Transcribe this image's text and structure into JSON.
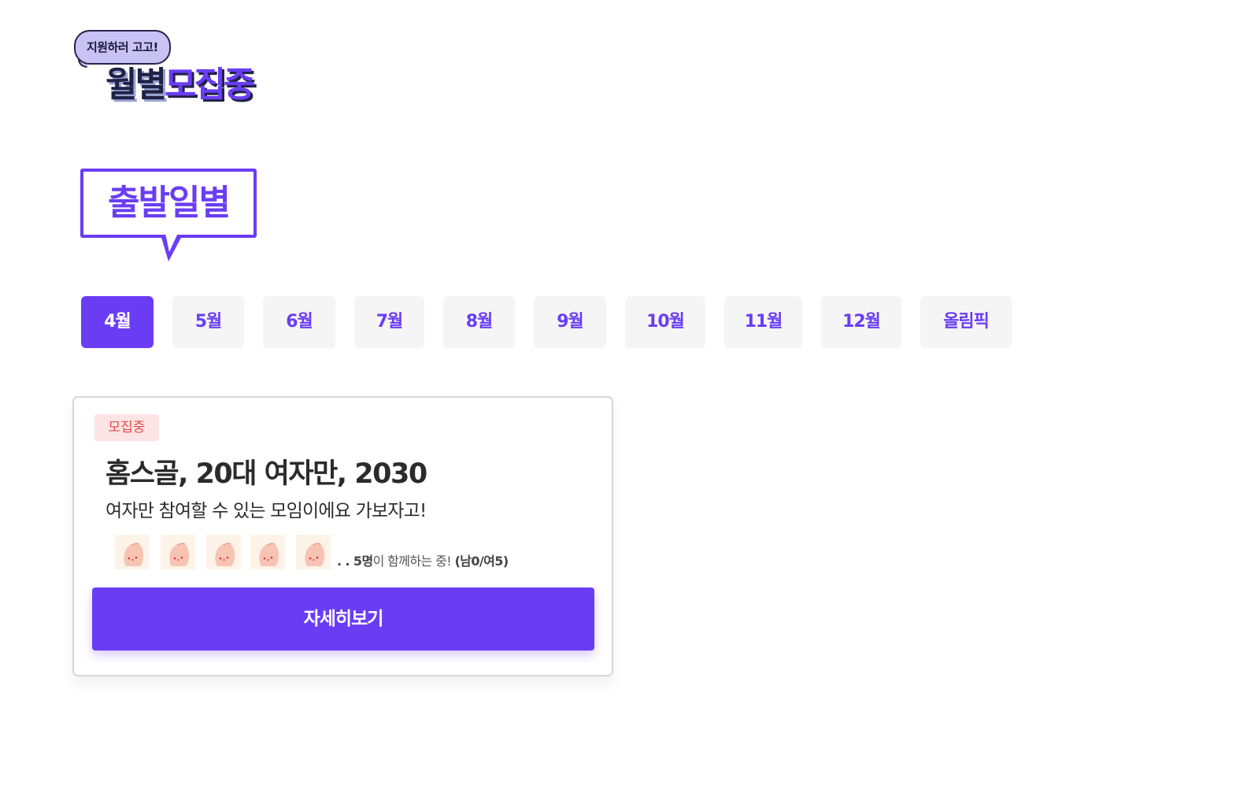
{
  "logo": {
    "bubble_text": "지원하러 고고!",
    "main_part1": "월별",
    "main_part2": "모집중"
  },
  "section": {
    "heading": "출발일별"
  },
  "tabs": [
    {
      "label": "4월",
      "active": true
    },
    {
      "label": "5월",
      "active": false
    },
    {
      "label": "6월",
      "active": false
    },
    {
      "label": "7월",
      "active": false
    },
    {
      "label": "8월",
      "active": false
    },
    {
      "label": "9월",
      "active": false
    },
    {
      "label": "10월",
      "active": false
    },
    {
      "label": "11월",
      "active": false
    },
    {
      "label": "12월",
      "active": false
    },
    {
      "label": "올림픽",
      "active": false
    }
  ],
  "card": {
    "badge": "모집중",
    "title": "홈스골, 20대 여자만, 2030",
    "description": "여자만 참여할 수 있는 모임이에요 가보자고!",
    "participants": {
      "prefix": ". . ",
      "count": "5명",
      "middle": "이 함께하는 중! ",
      "gender_breakdown": "(남0/여5)"
    },
    "avatar_count": 5,
    "avatar_icon": "peach-face-icon",
    "button_label": "자세히보기"
  },
  "colors": {
    "accent": "#6a3df5",
    "tab_bg": "#f5f5f6",
    "badge_bg": "#fde4e4",
    "badge_text": "#e44c4c",
    "logo_dark": "#1f2245"
  }
}
